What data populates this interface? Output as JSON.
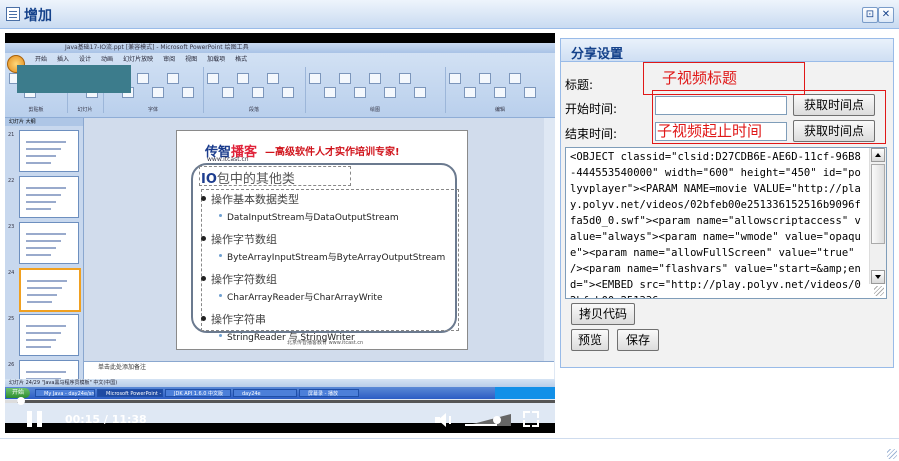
{
  "window": {
    "title": "增加",
    "restore_symbol": "⊡",
    "close_symbol": "✕",
    "accent": "#15428b"
  },
  "player": {
    "current_time": "00:15",
    "total_time": "11:38",
    "time_text": "00:15 / 11:38",
    "progress": 0.021,
    "volume": 0.7,
    "icons": [
      "pause-icon",
      "volume-icon",
      "fullscreen-icon"
    ]
  },
  "video_frame": {
    "window_title": "Java基础17-IO流.ppt [兼容模式] - Microsoft PowerPoint      绘图工具",
    "ribbon_tabs": [
      "开始",
      "插入",
      "设计",
      "动画",
      "幻灯片放映",
      "审阅",
      "视图",
      "加载项",
      "格式"
    ],
    "ribbon_groups": [
      "剪贴板",
      "幻灯片",
      "字体",
      "段落",
      "绘图",
      "编辑"
    ],
    "thumb_tabs": "幻灯片  大纲",
    "thumb_numbers": [
      "21",
      "22",
      "23",
      "24",
      "25",
      "26"
    ],
    "slide": {
      "logo_a": "传智",
      "logo_b": "播客",
      "logo_url": "www.itcast.cn",
      "slogan": "—高级软件人才实作培训专家!",
      "title_io": "IO",
      "title_rest": "包中的其他类",
      "items": [
        {
          "text": "操作基本数据类型",
          "sub": "DataInputStream与DataOutputStream"
        },
        {
          "text": "操作字节数组",
          "sub": "ByteArrayInputStream与ByteArrayOutputStream"
        },
        {
          "text": "操作字符数组",
          "sub": "CharArrayReader与CharArrayWrite"
        },
        {
          "text": "操作字符串",
          "sub": "StringReader 与 StringWriter"
        }
      ],
      "footer": "北京传智播客教育 www.itcast.cn"
    },
    "notes_placeholder": "单击此处添加备注",
    "status_text": "幻灯片 24/29   \"Java黑马程序员模板\"   中文(中国)",
    "taskbar": {
      "start": "开始",
      "tasks": [
        "My Java - day24e/src/cn/...",
        "Microsoft PowerPoint - [J...",
        "JDK API 1.6.0 中文版",
        "day24e",
        "屏幕录 - 播放"
      ]
    }
  },
  "share": {
    "header": "分享设置",
    "title_label": "标题:",
    "title_value": "",
    "start_label": "开始时间:",
    "start_value": "",
    "end_label": "结束时间:",
    "end_value": "",
    "get_time_button": "获取时间点",
    "code": "<OBJECT classid=\"clsid:D27CDB6E-AE6D-11cf-96B8-444553540000\" width=\"600\" height=\"450\" id=\"polyvplayer\"><PARAM NAME=movie VALUE=\"http://play.polyv.net/videos/02bfeb00e251336152516b9096ffa5d0_0.swf\"><param name=\"allowscriptaccess\" value=\"always\"><param name=\"wmode\" value=\"opaque\"><param name=\"allowFullScreen\" value=\"true\" /><param name=\"flashvars\" value=\"start=&amp;end=\"><EMBED src=\"http://play.polyv.net/videos/02bfeb00e251336",
    "copy_button": "拷贝代码",
    "preview_button": "预览",
    "save_button": "保存"
  },
  "annotations": {
    "title_note": "子视频标题",
    "time_note": "子视频起止时间",
    "color": "#e01818"
  }
}
